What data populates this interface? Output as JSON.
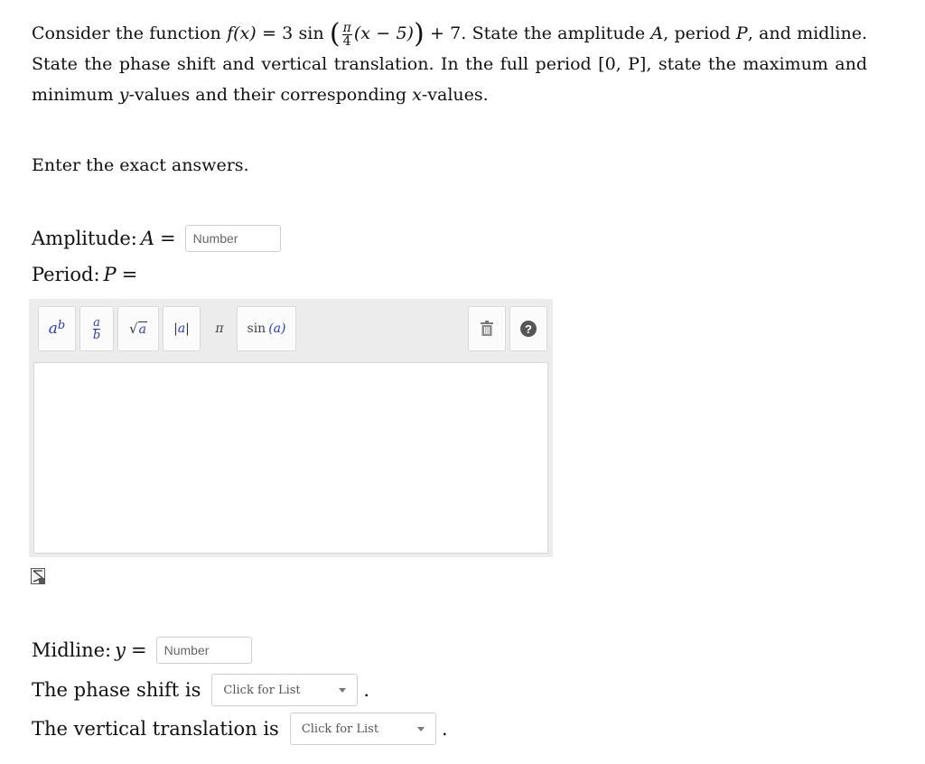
{
  "question": {
    "t1": "Consider the function ",
    "func_f": "f",
    "func_var": "(x)",
    "func_eq": " = 3 sin ",
    "frac_num": "π",
    "frac_den": "4",
    "inner": "(x − 5)",
    "plus7": " + 7",
    "t2": ". State the amplitude ",
    "A": "A",
    "t3": ", period ",
    "P": "P",
    "t4": ", and midline. State the phase shift and vertical translation. In the full period ",
    "interval": "[0, P]",
    "t5": ", state the maximum and minimum ",
    "yvar": "y",
    "t6": "-values and their corresponding ",
    "xvar": "x",
    "t7": "-values."
  },
  "instruction": "Enter the exact answers.",
  "amplitude": {
    "label": "Amplitude: ",
    "var": "A",
    "eq": " = ",
    "placeholder": "Number"
  },
  "period": {
    "label": "Period: ",
    "var": "P",
    "eq": " = "
  },
  "toolbar": {
    "power": {
      "base": "a",
      "exp": "b"
    },
    "fraction": {
      "num": "a",
      "den": "b"
    },
    "sqrt": {
      "sym": "√",
      "arg": "a"
    },
    "abs": {
      "l": "|",
      "arg": "a",
      "r": "|"
    },
    "pi": "π",
    "sin": {
      "fn": "sin",
      "arg": "(a)"
    },
    "help": "?"
  },
  "midline": {
    "label": "Midline: ",
    "var": "y",
    "eq": " = ",
    "placeholder": "Number"
  },
  "phase": {
    "label": "The phase shift is",
    "select": "Click for List",
    "end": "."
  },
  "vertical": {
    "label": "The vertical translation is",
    "select": "Click for List",
    "end": "."
  }
}
